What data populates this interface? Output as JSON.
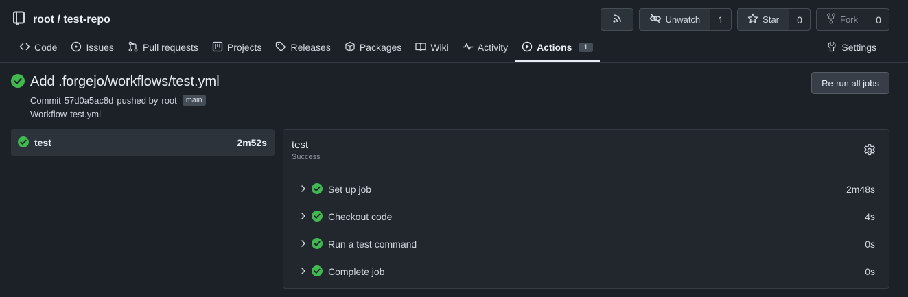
{
  "repo": {
    "title": "root / test-repo"
  },
  "header_buttons": {
    "watch_label": "Unwatch",
    "watch_count": "1",
    "star_label": "Star",
    "star_count": "0",
    "fork_label": "Fork",
    "fork_count": "0"
  },
  "tabs": [
    {
      "label": "Code",
      "icon": "code-icon"
    },
    {
      "label": "Issues",
      "icon": "issue-icon"
    },
    {
      "label": "Pull requests",
      "icon": "pull-request-icon"
    },
    {
      "label": "Projects",
      "icon": "project-icon"
    },
    {
      "label": "Releases",
      "icon": "tag-icon"
    },
    {
      "label": "Packages",
      "icon": "package-icon"
    },
    {
      "label": "Wiki",
      "icon": "book-icon"
    },
    {
      "label": "Activity",
      "icon": "pulse-icon"
    },
    {
      "label": "Actions",
      "icon": "play-icon",
      "badge": "1",
      "active": true
    }
  ],
  "settings_tab": {
    "label": "Settings"
  },
  "run": {
    "title": "Add .forgejo/workflows/test.yml",
    "commit_label": "Commit",
    "commit_sha": "57d0a5ac8d",
    "pushed_by": "pushed by",
    "author": "root",
    "branch": "main",
    "workflow_label": "Workflow",
    "workflow_file": "test.yml",
    "rerun_label": "Re-run all jobs"
  },
  "job_list": [
    {
      "name": "test",
      "duration": "2m52s",
      "status": "success"
    }
  ],
  "job_panel": {
    "name": "test",
    "status": "Success",
    "steps": [
      {
        "name": "Set up job",
        "duration": "2m48s"
      },
      {
        "name": "Checkout code",
        "duration": "4s"
      },
      {
        "name": "Run a test command",
        "duration": "0s"
      },
      {
        "name": "Complete job",
        "duration": "0s"
      }
    ]
  },
  "colors": {
    "success": "#3fb950",
    "background": "#1c2128"
  }
}
